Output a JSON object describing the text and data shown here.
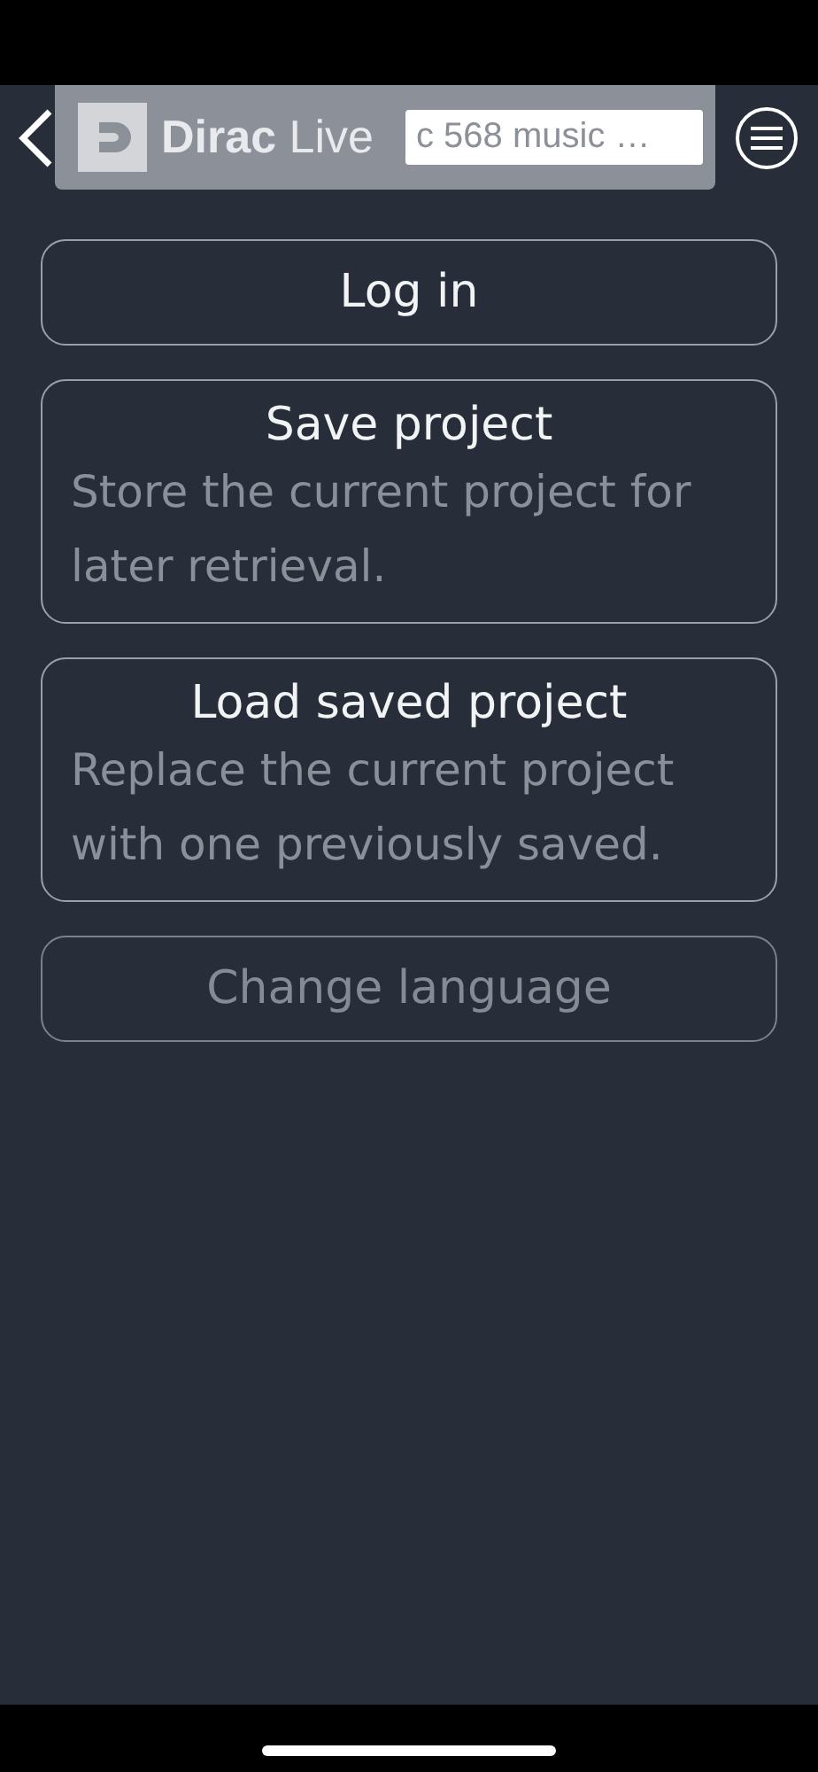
{
  "header": {
    "brand": "**Dirac** Live",
    "project_field": {
      "value": "c 568 music …"
    }
  },
  "menu_items": [
    {
      "kind": "simple",
      "title": "Log in",
      "disabled": false
    },
    {
      "kind": "described",
      "title": "Save project",
      "description": "Store the current project for later retrieval.",
      "disabled": false
    },
    {
      "kind": "described",
      "title": "Load saved project",
      "description": "Replace the current project with one previously saved.",
      "disabled": false
    },
    {
      "kind": "simple",
      "title": "Change language",
      "disabled": true
    }
  ]
}
